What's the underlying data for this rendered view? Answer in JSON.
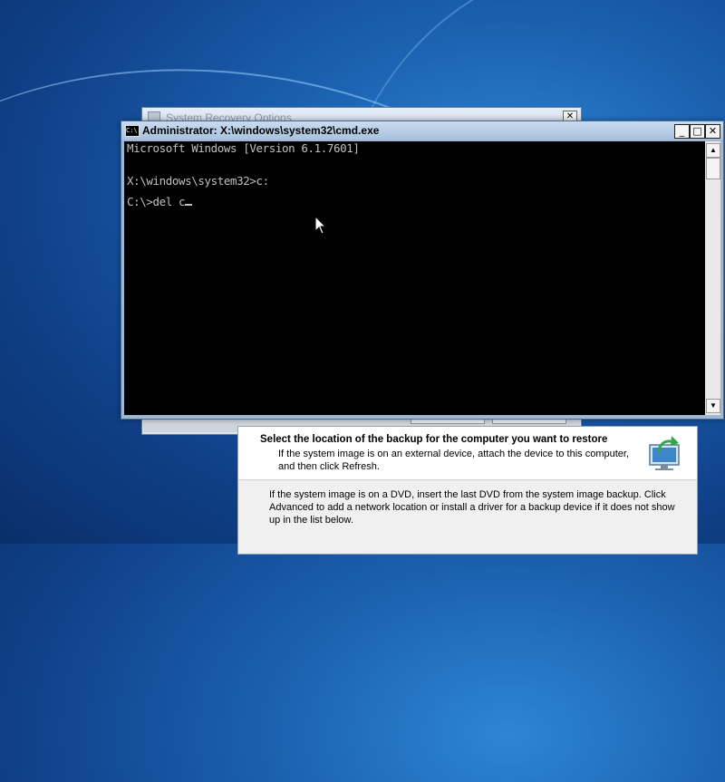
{
  "background_window": {
    "title": "System Recovery Options",
    "close_label": "✕"
  },
  "restore_dialog": {
    "heading": "Select the location of the backup for the computer you want to restore",
    "subtext": "If the system image is on an external device, attach the device to this computer, and then click Refresh.",
    "body_text": "If the system image is on a DVD, insert the last DVD from the system image backup. Click Advanced to add a network location or install a driver for a backup device if it does not show up in the list below."
  },
  "cmd_window": {
    "icon_label": "C:\\",
    "title": "Administrator: X:\\windows\\system32\\cmd.exe",
    "minimize_label": "_",
    "maximize_label": "□",
    "close_label": "✕",
    "lines": [
      "Microsoft Windows [Version 6.1.7601]",
      "",
      "X:\\windows\\system32>c:",
      "",
      "C:\\>del c"
    ]
  },
  "colors": {
    "console_bg": "#000000",
    "console_text": "#c0c0c0",
    "desktop_accent": "#1a5fae"
  }
}
